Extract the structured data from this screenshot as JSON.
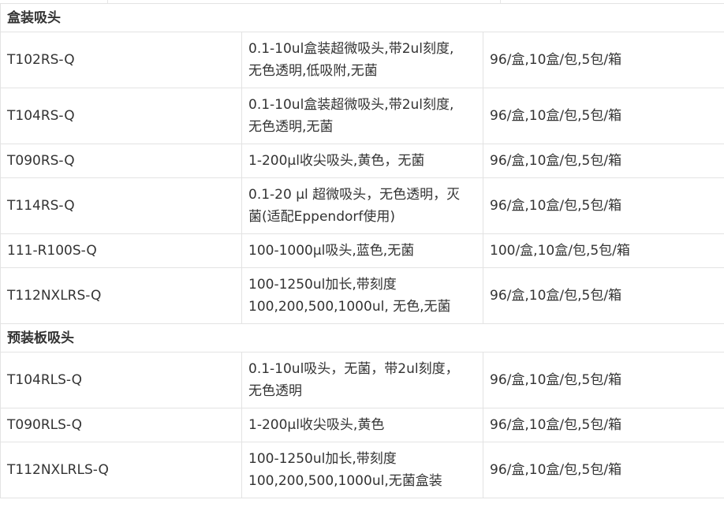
{
  "sections": [
    {
      "title": "盒装吸头",
      "rows": [
        {
          "code": "T102RS-Q",
          "desc_lines": [
            "0.1-10ul盒装超微吸头,带2ul刻度,",
            "无色透明,低吸附,无菌"
          ],
          "packing": "96/盒,10盒/包,5包/箱"
        },
        {
          "code": "T104RS-Q",
          "desc_lines": [
            "0.1-10ul盒装超微吸头,带2ul刻度,",
            "无色透明,无菌"
          ],
          "packing": "96/盒,10盒/包,5包/箱"
        },
        {
          "code": "T090RS-Q",
          "desc_lines": [
            "1-200µl收尖吸头,黄色，无菌"
          ],
          "packing": "96/盒,10盒/包,5包/箱"
        },
        {
          "code": "T114RS-Q",
          "desc_lines": [
            "0.1-20 µl 超微吸头，无色透明，灭",
            "菌(适配Eppendorf使用)"
          ],
          "packing": "96/盒,10盒/包,5包/箱"
        },
        {
          "code": "111-R100S-Q",
          "desc_lines": [
            "100-1000µl吸头,蓝色,无菌"
          ],
          "packing": "100/盒,10盒/包,5包/箱"
        },
        {
          "code": "T112NXLRS-Q",
          "desc_lines": [
            "100-1250ul加长,带刻度",
            "100,200,500,1000ul, 无色,无菌"
          ],
          "packing": "96/盒,10盒/包,5包/箱"
        }
      ]
    },
    {
      "title": "预装板吸头",
      "rows": [
        {
          "code": "T104RLS-Q",
          "desc_lines": [
            "0.1-10ul吸头，无菌，带2ul刻度，",
            "无色透明"
          ],
          "packing": "96/盒,10盒/包,5包/箱"
        },
        {
          "code": "T090RLS-Q",
          "desc_lines": [
            "1-200µl收尖吸头,黄色"
          ],
          "packing": "96/盒,10盒/包,5包/箱"
        },
        {
          "code": "T112NXLRLS-Q",
          "desc_lines": [
            "100-1250ul加长,带刻度",
            "100,200,500,1000ul,无菌盒装"
          ],
          "packing": "96/盒,10盒/包,5包/箱"
        }
      ]
    }
  ]
}
